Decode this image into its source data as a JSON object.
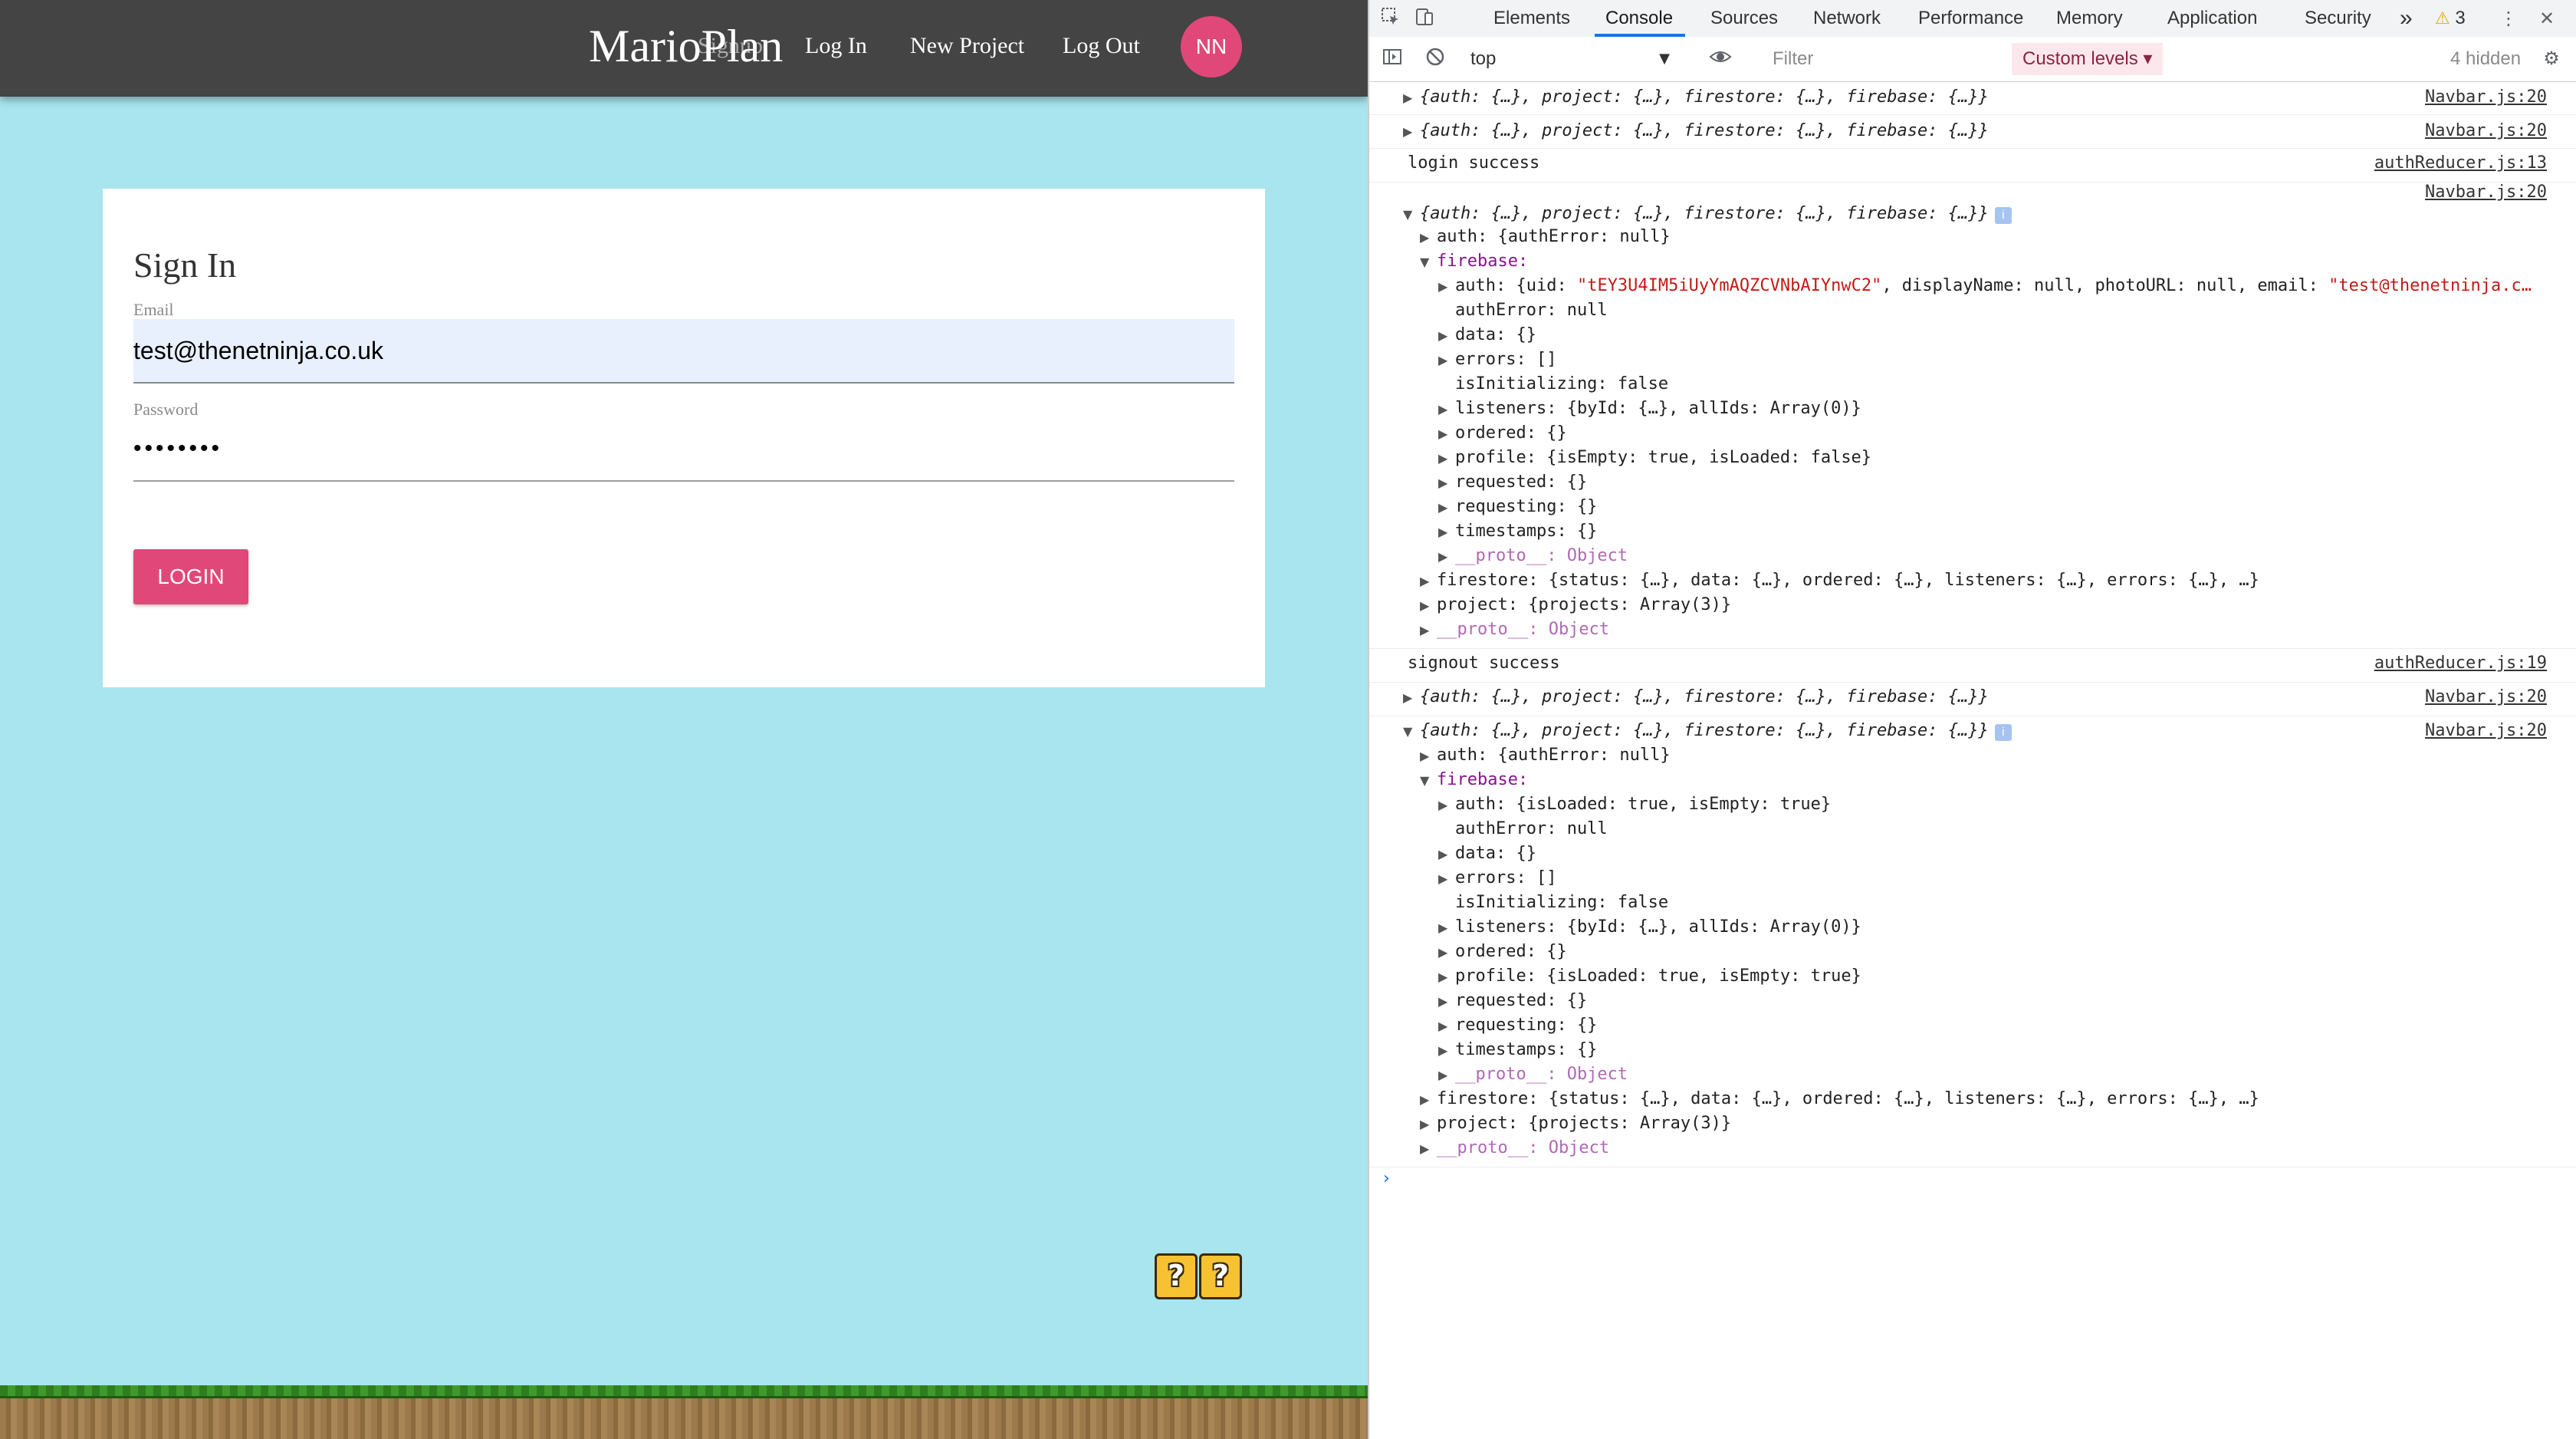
{
  "app": {
    "brand": "MarioPlan",
    "nav": {
      "signup": "Signup",
      "login": "Log In",
      "new_project": "New Project",
      "logout": "Log Out",
      "avatar_initials": "NN"
    },
    "signin": {
      "title": "Sign In",
      "email_label": "Email",
      "email_value": "test@thenetninja.co.uk",
      "password_label": "Password",
      "password_value": "••••••••",
      "login_button": "LOGIN"
    },
    "question_block_glyph": "?",
    "colors": {
      "navbar": "#444444",
      "background": "#a8e5ee",
      "accent": "#e0487a"
    }
  },
  "devtools": {
    "tabs": [
      "Elements",
      "Console",
      "Sources",
      "Network",
      "Performance",
      "Memory",
      "Application",
      "Security"
    ],
    "active_tab": "Console",
    "more_tabs_glyph": "»",
    "warning_count": "3",
    "toolbar": {
      "context": "top",
      "filter_placeholder": "Filter",
      "levels": "Custom levels ▾",
      "hidden": "4 hidden"
    },
    "console": {
      "sources": {
        "navbar": "Navbar.js:20",
        "auth13": "authReducer.js:13",
        "auth19": "authReducer.js:19"
      },
      "collapsed_state": "{auth: {…}, project: {…}, firestore: {…}, firebase: {…}}",
      "messages": {
        "login": "login success",
        "signout": "signout success"
      },
      "first_expanded": {
        "auth": "auth: {authError: null}",
        "firebase": "firebase:",
        "fb_auth_prefix": "auth: {uid: ",
        "fb_auth_uid": "\"tEY3U4IM5iUyYmAQZCVNbAIYnwC2\"",
        "fb_auth_mid": ", displayName: null, photoURL: null, email: ",
        "fb_auth_email": "\"test@thenetninja.c…",
        "authError": "authError: null",
        "data": "data: {}",
        "errors": "errors: []",
        "isInitializing": "isInitializing: false",
        "listeners": "listeners: {byId: {…}, allIds: Array(0)}",
        "ordered": "ordered: {}",
        "profile": "profile: {isEmpty: true, isLoaded: false}",
        "requested": "requested: {}",
        "requesting": "requesting: {}",
        "timestamps": "timestamps: {}",
        "proto": "__proto__: Object",
        "firestore": "firestore: {status: {…}, data: {…}, ordered: {…}, listeners: {…}, errors: {…}, …}",
        "project": "project: {projects: Array(3)}",
        "proto_root": "__proto__: Object"
      },
      "second_expanded": {
        "auth": "auth: {authError: null}",
        "firebase": "firebase:",
        "fb_auth": "auth: {isLoaded: true, isEmpty: true}",
        "authError": "authError: null",
        "data": "data: {}",
        "errors": "errors: []",
        "isInitializing": "isInitializing: false",
        "listeners": "listeners: {byId: {…}, allIds: Array(0)}",
        "ordered": "ordered: {}",
        "profile": "profile: {isLoaded: true, isEmpty: true}",
        "requested": "requested: {}",
        "requesting": "requesting: {}",
        "timestamps": "timestamps: {}",
        "proto": "__proto__: Object",
        "firestore": "firestore: {status: {…}, data: {…}, ordered: {…}, listeners: {…}, errors: {…}, …}",
        "project": "project: {projects: Array(3)}",
        "proto_root": "__proto__: Object"
      },
      "prompt": "›",
      "info_badge": "i"
    }
  }
}
